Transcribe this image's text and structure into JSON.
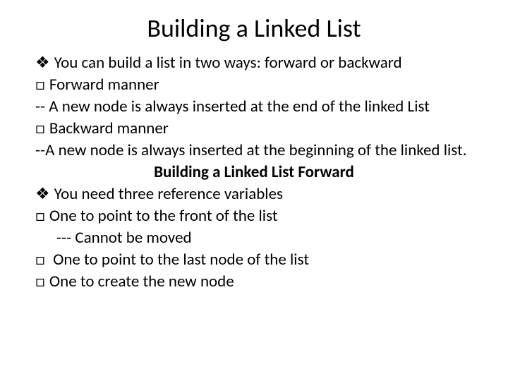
{
  "title": "Building a Linked List",
  "lines": {
    "l1": "You can build a list in two ways: forward or backward",
    "l2": "Forward manner",
    "l3": "-- A new node is always inserted at the end of the linked List",
    "l4": "Backward manner",
    "l5": "--A new node is always inserted at the beginning of the linked list.",
    "l6": "Building a Linked List Forward",
    "l7": "You need three reference variables",
    "l8": "One to point to the front of the list",
    "l9": "--- Cannot be moved",
    "l10": " One to point to the last node of the list",
    "l11": "One to create the new node"
  }
}
